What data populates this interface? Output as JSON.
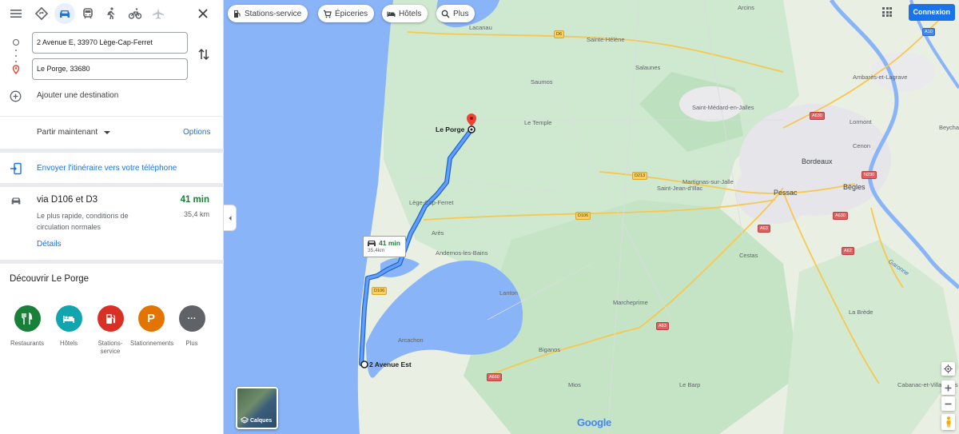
{
  "panel": {
    "modes": [
      "menu",
      "best",
      "car",
      "transit",
      "walk",
      "bicycle",
      "flight",
      "close"
    ],
    "origin": "2 Avenue E, 33970 Lège-Cap-Ferret",
    "destination": "Le Porge, 33680",
    "add_destination": "Ajouter une destination",
    "depart": "Partir maintenant",
    "options": "Options",
    "send_to_phone": "Envoyer l'itinéraire vers votre téléphone",
    "route": {
      "title": "via D106 et D3",
      "time": "41 min",
      "desc": "Le plus rapide, conditions de circulation normales",
      "distance": "35,4 km",
      "details": "Détails"
    },
    "discover_title": "Découvrir Le Porge",
    "categories": [
      {
        "label": "Restaurants",
        "color": "#188038",
        "icon": "fork-knife-icon"
      },
      {
        "label": "Hôtels",
        "color": "#12a4af",
        "icon": "bed-icon"
      },
      {
        "label": "Stations-service",
        "color": "#d93025",
        "icon": "fuel-pump-icon"
      },
      {
        "label": "Stationnements",
        "color": "#e37400",
        "icon": "parking-icon",
        "glyph": "P"
      },
      {
        "label": "Plus",
        "color": "#5f6368",
        "icon": "more-dots-icon",
        "glyph": "···"
      }
    ]
  },
  "map": {
    "chips": [
      "Stations-service",
      "Épiceries",
      "Hôtels",
      "Plus"
    ],
    "signin": "Connexion",
    "callout_time": "41 min",
    "callout_dist": "35,4km",
    "origin_label": "2 Avenue Est",
    "dest_label": "Le Porge",
    "layers": "Calques",
    "brand": "Google",
    "places": {
      "arcins": "Arcins",
      "lacanau": "Lacanau",
      "sainte_helene": "Sainte-Hélène",
      "salaunes": "Salaunes",
      "saumos": "Saumos",
      "ambares": "Ambarès-et-Lagrave",
      "st_medard": "Saint-Médard-en-Jalles",
      "le_temple": "Le Temple",
      "lormont": "Lormont",
      "beychac": "Beychac",
      "cenon": "Cenon",
      "bordeaux": "Bordeaux",
      "martignas": "Martignas-sur-Jalle",
      "st_jean": "Saint-Jean-d'Illac",
      "pessac": "Pessac",
      "begles": "Bègles",
      "lege": "Lège-Cap-Ferret",
      "ares": "Arès",
      "andernos": "Andernos-les-Bains",
      "lanton": "Lanton",
      "marcheprime": "Marcheprime",
      "cestas": "Cestas",
      "arcachon": "Arcachon",
      "biganos": "Biganos",
      "la_brede": "La Brède",
      "mios": "Mios",
      "le_barp": "Le Barp",
      "cabanac": "Cabanac-et-Villagrains",
      "garonne": "Garonne"
    },
    "roads": {
      "d6": "D6",
      "a10": "A10",
      "a630a": "A630",
      "a630b": "A630",
      "n230": "N230",
      "d213": "D213",
      "d106a": "D106",
      "d106b": "D106",
      "a63a": "A63",
      "a62": "A62",
      "a63b": "A63",
      "a660": "A660"
    }
  }
}
